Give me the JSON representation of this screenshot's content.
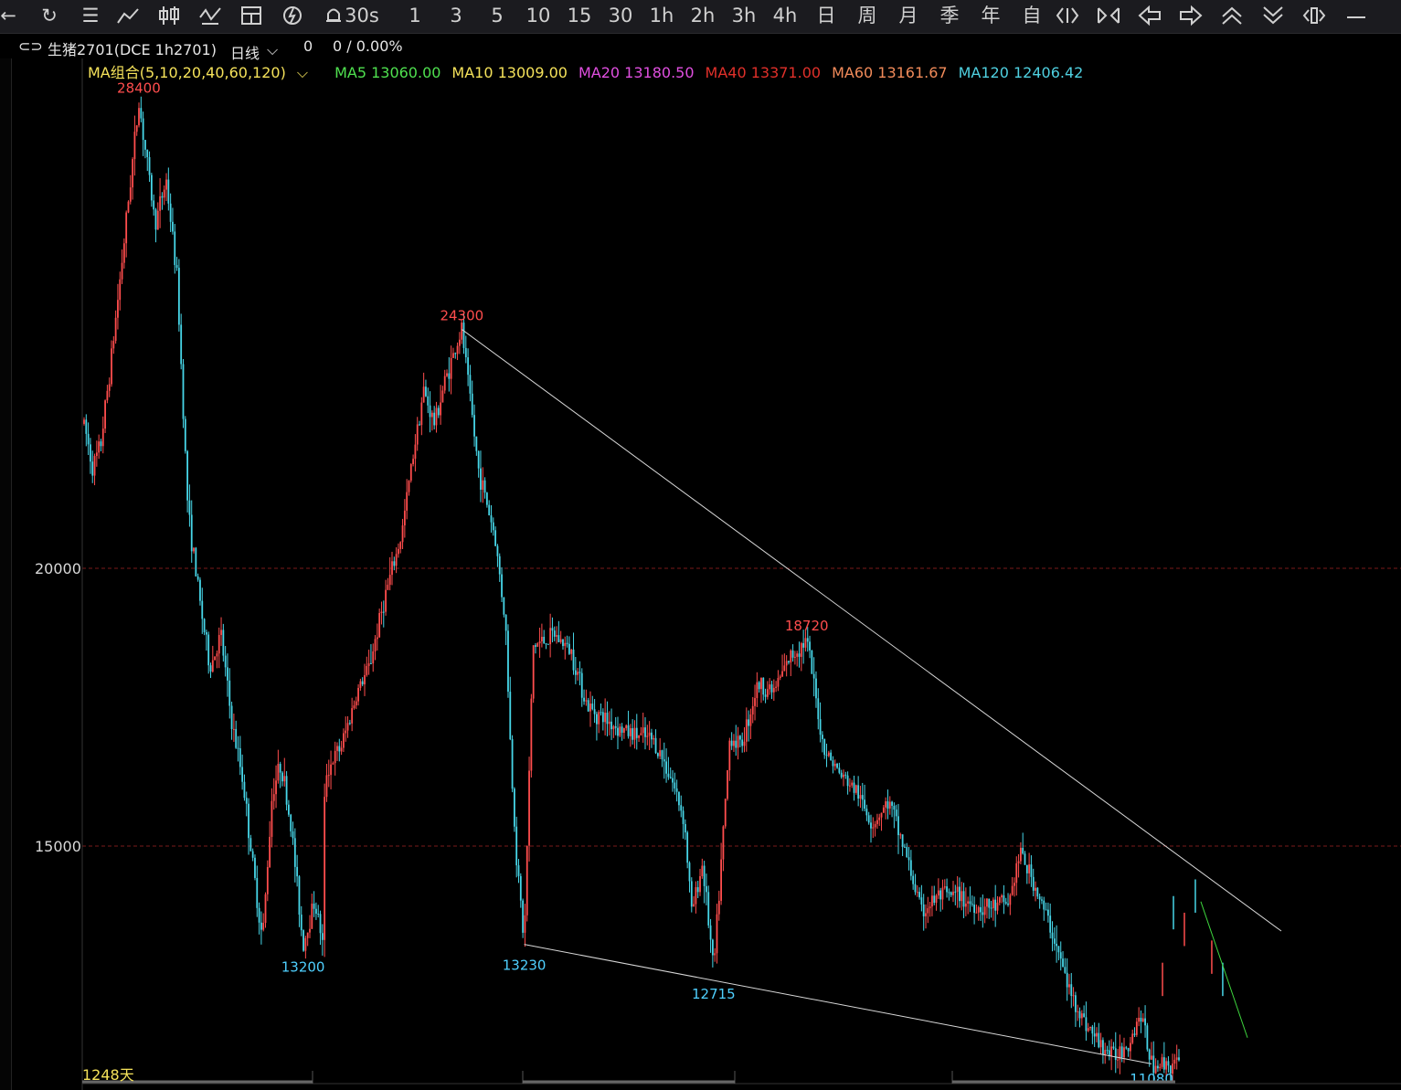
{
  "toolbar": {
    "items": [
      {
        "name": "back-icon",
        "label": "←"
      },
      {
        "name": "refresh-icon",
        "label": "↻"
      },
      {
        "name": "list-icon",
        "label": "☰"
      },
      {
        "name": "line-chart-icon",
        "label": ""
      },
      {
        "name": "candle-icon",
        "label": ""
      },
      {
        "name": "split-icon",
        "label": ""
      },
      {
        "name": "grid-chart-icon",
        "label": ""
      },
      {
        "name": "lightning-icon",
        "label": ""
      },
      {
        "name": "bell-icon",
        "label": ""
      }
    ],
    "periods": [
      "30s",
      "1",
      "3",
      "5",
      "10",
      "15",
      "30",
      "1h",
      "2h",
      "3h",
      "4h",
      "日",
      "周",
      "月",
      "季",
      "年",
      "自"
    ],
    "nav": [
      {
        "name": "zoom-in-icon"
      },
      {
        "name": "zoom-out-icon"
      },
      {
        "name": "arrow-left-icon"
      },
      {
        "name": "arrow-right-icon"
      },
      {
        "name": "arrow-up-icon"
      },
      {
        "name": "arrow-down-icon"
      },
      {
        "name": "fit-icon"
      },
      {
        "name": "minimize-icon"
      }
    ]
  },
  "infobar": {
    "contract": "生猪2701(DCE 1h2701)",
    "period": "日线",
    "value1": "0",
    "value2": "0 / 0.00%"
  },
  "ma": {
    "combo": "MA组合(5,10,20,40,60,120)",
    "items": [
      {
        "label": "MA5 13060.00",
        "color": "#4fe04f"
      },
      {
        "label": "MA10 13009.00",
        "color": "#f5e25a"
      },
      {
        "label": "MA20 13180.50",
        "color": "#e04fe0"
      },
      {
        "label": "MA40 13371.00",
        "color": "#e0302a"
      },
      {
        "label": "MA60 13161.67",
        "color": "#f28b5a"
      },
      {
        "label": "MA120 12406.42",
        "color": "#4fd0e0"
      }
    ]
  },
  "chart_data": {
    "type": "candlestick",
    "symbol": "生猪2701",
    "yticks": [
      20000,
      15000
    ],
    "ylim": [
      10700,
      29200
    ],
    "highs": [
      {
        "label": "28400",
        "value": 28400,
        "t": 0.05
      },
      {
        "label": "24300",
        "value": 24300,
        "t": 0.345
      },
      {
        "label": "18720",
        "value": 18720,
        "t": 0.66
      }
    ],
    "lows": [
      {
        "label": "13200",
        "value": 13200,
        "t": 0.2
      },
      {
        "label": "13230",
        "value": 13230,
        "t": 0.402
      },
      {
        "label": "12715",
        "value": 12715,
        "t": 0.575
      },
      {
        "label": "11080",
        "value": 11080,
        "t": 0.975
      }
    ],
    "days_label": "1248天",
    "colors": {
      "up": "#ff4d4d",
      "down": "#47d6e8",
      "grid": "#7a1a1a",
      "trend": "#d8d8d8",
      "hi": "#ff4d4d",
      "lo": "#4fd0ff"
    }
  }
}
